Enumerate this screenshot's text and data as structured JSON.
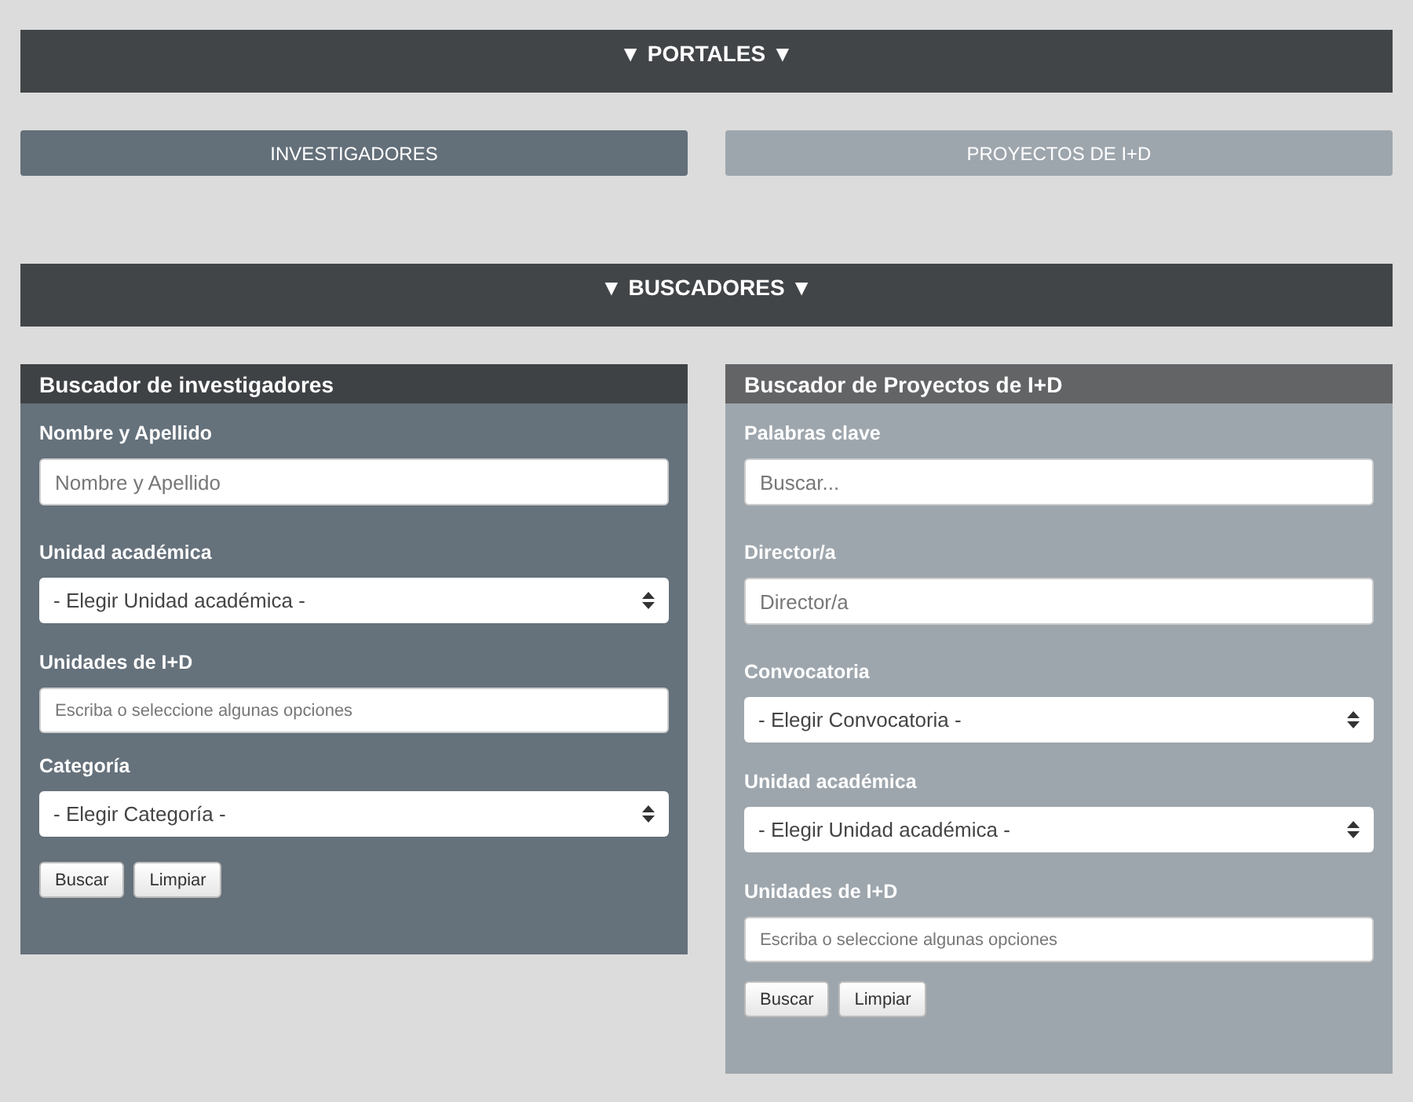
{
  "portals_header": "▼ PORTALES ▼",
  "portals": [
    {
      "label": "INVESTIGADORES",
      "kind": "dark"
    },
    {
      "label": "PROYECTOS DE I+D",
      "kind": "light"
    }
  ],
  "search_header": "▼ BUSCADORES ▼",
  "panels": [
    {
      "title": "Buscador de investigadores",
      "kind": "dark",
      "fields": [
        {
          "label": "Nombre y Apellido",
          "kind": "text",
          "placeholder": "Nombre y Apellido"
        },
        {
          "label": "Unidad académica",
          "kind": "select",
          "value": "- Elegir Unidad académica -"
        },
        {
          "label": "Unidades de I+D",
          "kind": "tags",
          "placeholder": "Escriba o seleccione algunas opciones"
        },
        {
          "label": "Categoría",
          "kind": "select",
          "value": "- Elegir Categoría -"
        }
      ],
      "buttons": [
        "Buscar",
        "Limpiar"
      ]
    },
    {
      "title": "Buscador de Proyectos de I+D",
      "kind": "light",
      "fields": [
        {
          "label": "Palabras clave",
          "kind": "text",
          "placeholder": "Buscar..."
        },
        {
          "label": "Director/a",
          "kind": "text",
          "placeholder": "Director/a"
        },
        {
          "label": "Convocatoria",
          "kind": "select",
          "value": "- Elegir Convocatoria -"
        },
        {
          "label": "Unidad académica",
          "kind": "select",
          "value": "- Elegir Unidad académica -"
        },
        {
          "label": "Unidades de I+D",
          "kind": "tags",
          "placeholder": "Escriba o seleccione algunas opciones"
        }
      ],
      "buttons": [
        "Buscar",
        "Limpiar"
      ]
    }
  ]
}
